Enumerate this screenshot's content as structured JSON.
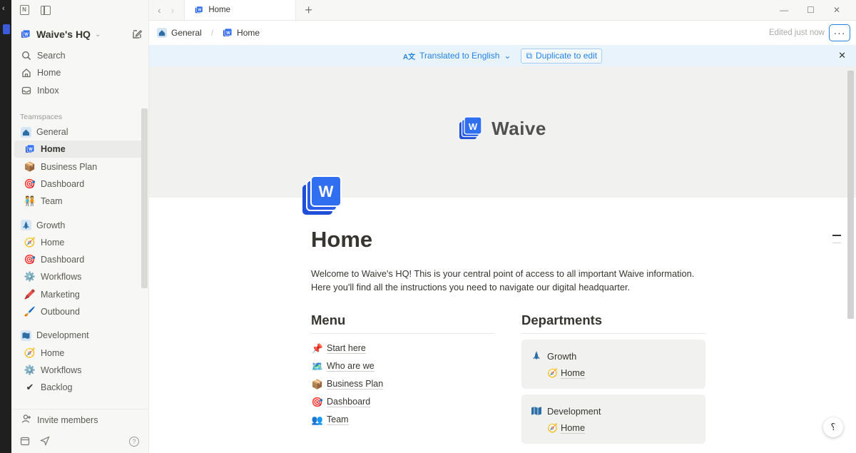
{
  "workspace": {
    "name": "Waive's HQ"
  },
  "sidebar": {
    "top": [
      {
        "label": "Search",
        "icon": "search-icon"
      },
      {
        "label": "Home",
        "icon": "home-icon"
      },
      {
        "label": "Inbox",
        "icon": "inbox-icon"
      }
    ],
    "section_label": "Teamspaces",
    "teamspaces": [
      {
        "label": "General",
        "icon": "house-icon",
        "items": [
          {
            "label": "Home",
            "icon": "waive-logo-icon",
            "active": true
          },
          {
            "label": "Business Plan",
            "icon": "package-icon"
          },
          {
            "label": "Dashboard",
            "icon": "target-icon"
          },
          {
            "label": "Team",
            "icon": "people-icon"
          }
        ]
      },
      {
        "label": "Growth",
        "icon": "rocket-icon",
        "items": [
          {
            "label": "Home",
            "icon": "compass-icon"
          },
          {
            "label": "Dashboard",
            "icon": "target-icon"
          },
          {
            "label": "Workflows",
            "icon": "gear-icon"
          },
          {
            "label": "Marketing",
            "icon": "pen-icon"
          },
          {
            "label": "Outbound",
            "icon": "brush-icon"
          }
        ]
      },
      {
        "label": "Development",
        "icon": "map-icon",
        "items": [
          {
            "label": "Home",
            "icon": "compass-icon"
          },
          {
            "label": "Workflows",
            "icon": "gear-icon"
          },
          {
            "label": "Backlog",
            "icon": "check-icon"
          }
        ]
      }
    ],
    "invite": "Invite members"
  },
  "tabbar": {
    "tab_title": "Home"
  },
  "topbar": {
    "breadcrumbs": [
      "General",
      "Home"
    ],
    "edited": "Edited just now",
    "more": "···"
  },
  "translation": {
    "translated": "Translated to English",
    "duplicate": "Duplicate to edit"
  },
  "cover": {
    "brand": "Waive"
  },
  "page": {
    "title": "Home",
    "intro": "Welcome to Waive's HQ! This is your central point of access to all important Waive information. Here you'll find all the instructions you need to navigate our digital headquarter."
  },
  "menu": {
    "heading": "Menu",
    "items": [
      {
        "icon": "📌",
        "label": "Start here"
      },
      {
        "icon": "🗺️",
        "label": "Who are we"
      },
      {
        "icon": "📦",
        "label": "Business Plan"
      },
      {
        "icon": "🎯",
        "label": "Dashboard"
      },
      {
        "icon": "👥",
        "label": "Team"
      }
    ]
  },
  "departments": {
    "heading": "Departments",
    "cards": [
      {
        "name": "Growth",
        "sub": "Home"
      },
      {
        "name": "Development",
        "sub": "Home"
      }
    ]
  },
  "colors": {
    "accent": "#2383e2",
    "brand": "#1f4fd6"
  }
}
